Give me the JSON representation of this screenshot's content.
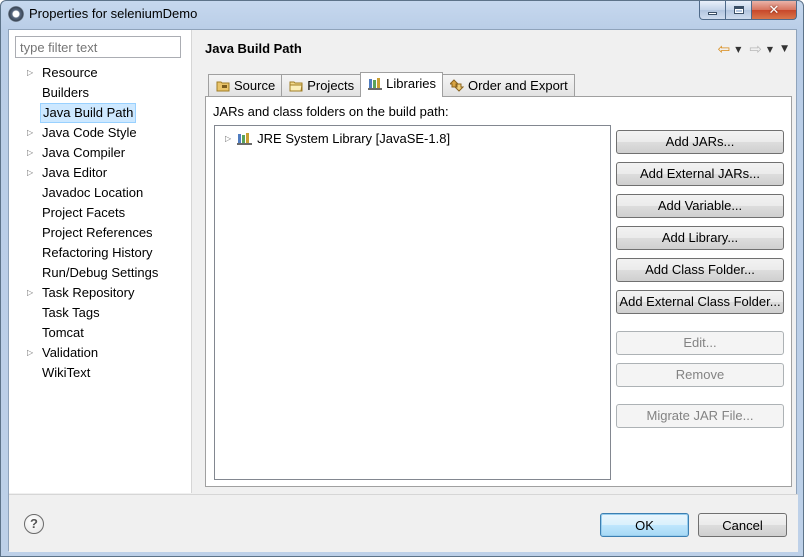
{
  "window": {
    "title": "Properties for seleniumDemo",
    "controls": {
      "minimize": "minimize",
      "maximize": "maximize",
      "close": "✕"
    }
  },
  "sidebar": {
    "filter_placeholder": "type filter text",
    "items": [
      {
        "label": "Resource",
        "expandable": true
      },
      {
        "label": "Builders",
        "expandable": false
      },
      {
        "label": "Java Build Path",
        "expandable": false,
        "selected": true
      },
      {
        "label": "Java Code Style",
        "expandable": true
      },
      {
        "label": "Java Compiler",
        "expandable": true
      },
      {
        "label": "Java Editor",
        "expandable": true
      },
      {
        "label": "Javadoc Location",
        "expandable": false
      },
      {
        "label": "Project Facets",
        "expandable": false
      },
      {
        "label": "Project References",
        "expandable": false
      },
      {
        "label": "Refactoring History",
        "expandable": false
      },
      {
        "label": "Run/Debug Settings",
        "expandable": false
      },
      {
        "label": "Task Repository",
        "expandable": true
      },
      {
        "label": "Task Tags",
        "expandable": false
      },
      {
        "label": "Tomcat",
        "expandable": false
      },
      {
        "label": "Validation",
        "expandable": true
      },
      {
        "label": "WikiText",
        "expandable": false
      }
    ]
  },
  "main": {
    "title": "Java Build Path",
    "tabs": [
      {
        "label": "Source",
        "icon": "source-folder-icon"
      },
      {
        "label": "Projects",
        "icon": "projects-icon"
      },
      {
        "label": "Libraries",
        "icon": "libraries-icon",
        "active": true
      },
      {
        "label": "Order and Export",
        "icon": "order-export-icon"
      }
    ],
    "heading": "JARs and class folders on the build path:",
    "libraries": [
      {
        "label": "JRE System Library [JavaSE-1.8]",
        "icon": "library-icon"
      }
    ],
    "buttons": [
      {
        "label": "Add JARs...",
        "enabled": true
      },
      {
        "label": "Add External JARs...",
        "enabled": true
      },
      {
        "label": "Add Variable...",
        "enabled": true
      },
      {
        "label": "Add Library...",
        "enabled": true
      },
      {
        "label": "Add Class Folder...",
        "enabled": true
      },
      {
        "label": "Add External Class Folder...",
        "enabled": true
      },
      {
        "label": "Edit...",
        "enabled": false
      },
      {
        "label": "Remove",
        "enabled": false
      },
      {
        "label": "Migrate JAR File...",
        "enabled": false
      }
    ]
  },
  "footer": {
    "help": "?",
    "ok_label": "OK",
    "cancel_label": "Cancel"
  },
  "colors": {
    "selection_bg": "#cde8ff",
    "nav_back": "#d88a18",
    "titlebar": "#c6d8ee"
  }
}
